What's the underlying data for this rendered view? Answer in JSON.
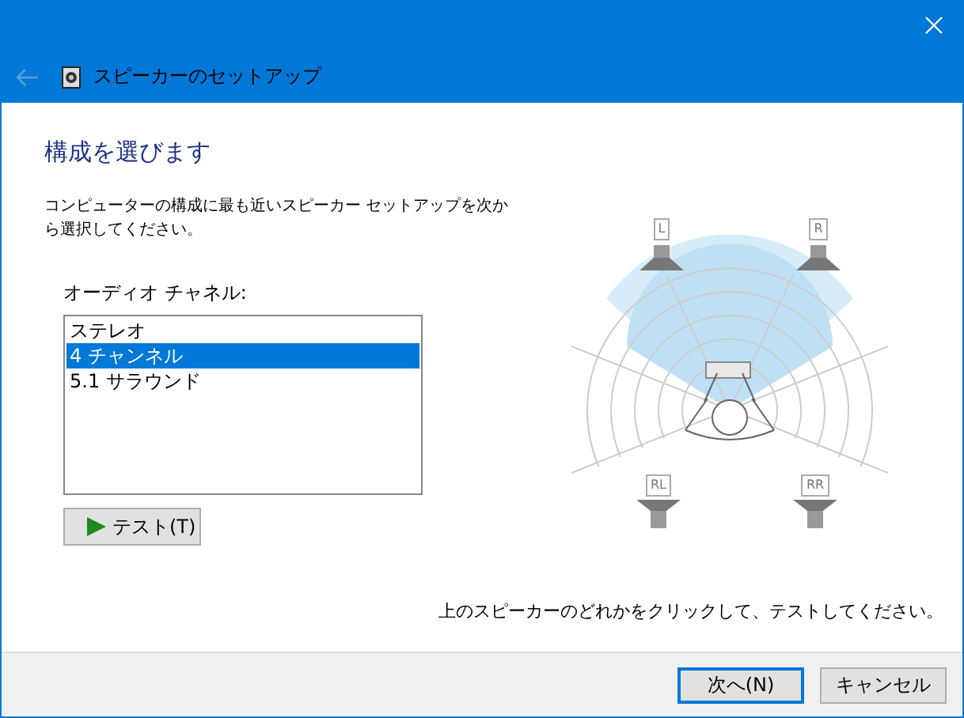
{
  "window": {
    "title": "スピーカーのセットアップ",
    "back_button": {
      "disabled": true
    }
  },
  "heading": "構成を選びます",
  "description": "コンピューターの構成に最も近いスピーカー セットアップを次から選択してください。",
  "channel_label": "オーディオ チャネル:",
  "channels": [
    {
      "label": "ステレオ",
      "selected": false
    },
    {
      "label": "4 チャンネル",
      "selected": true
    },
    {
      "label": "5.1 サラウンド",
      "selected": false
    }
  ],
  "test_button": "テスト(T)",
  "speakers": [
    {
      "label": "L",
      "kind": "front"
    },
    {
      "label": "R",
      "kind": "front"
    },
    {
      "label": "RL",
      "kind": "rear"
    },
    {
      "label": "RR",
      "kind": "rear"
    }
  ],
  "instruction": "上のスピーカーのどれかをクリックして、テストしてください。",
  "buttons": [
    {
      "label": "次へ(N)",
      "default": true
    },
    {
      "label": "キャンセル",
      "default": false
    }
  ]
}
